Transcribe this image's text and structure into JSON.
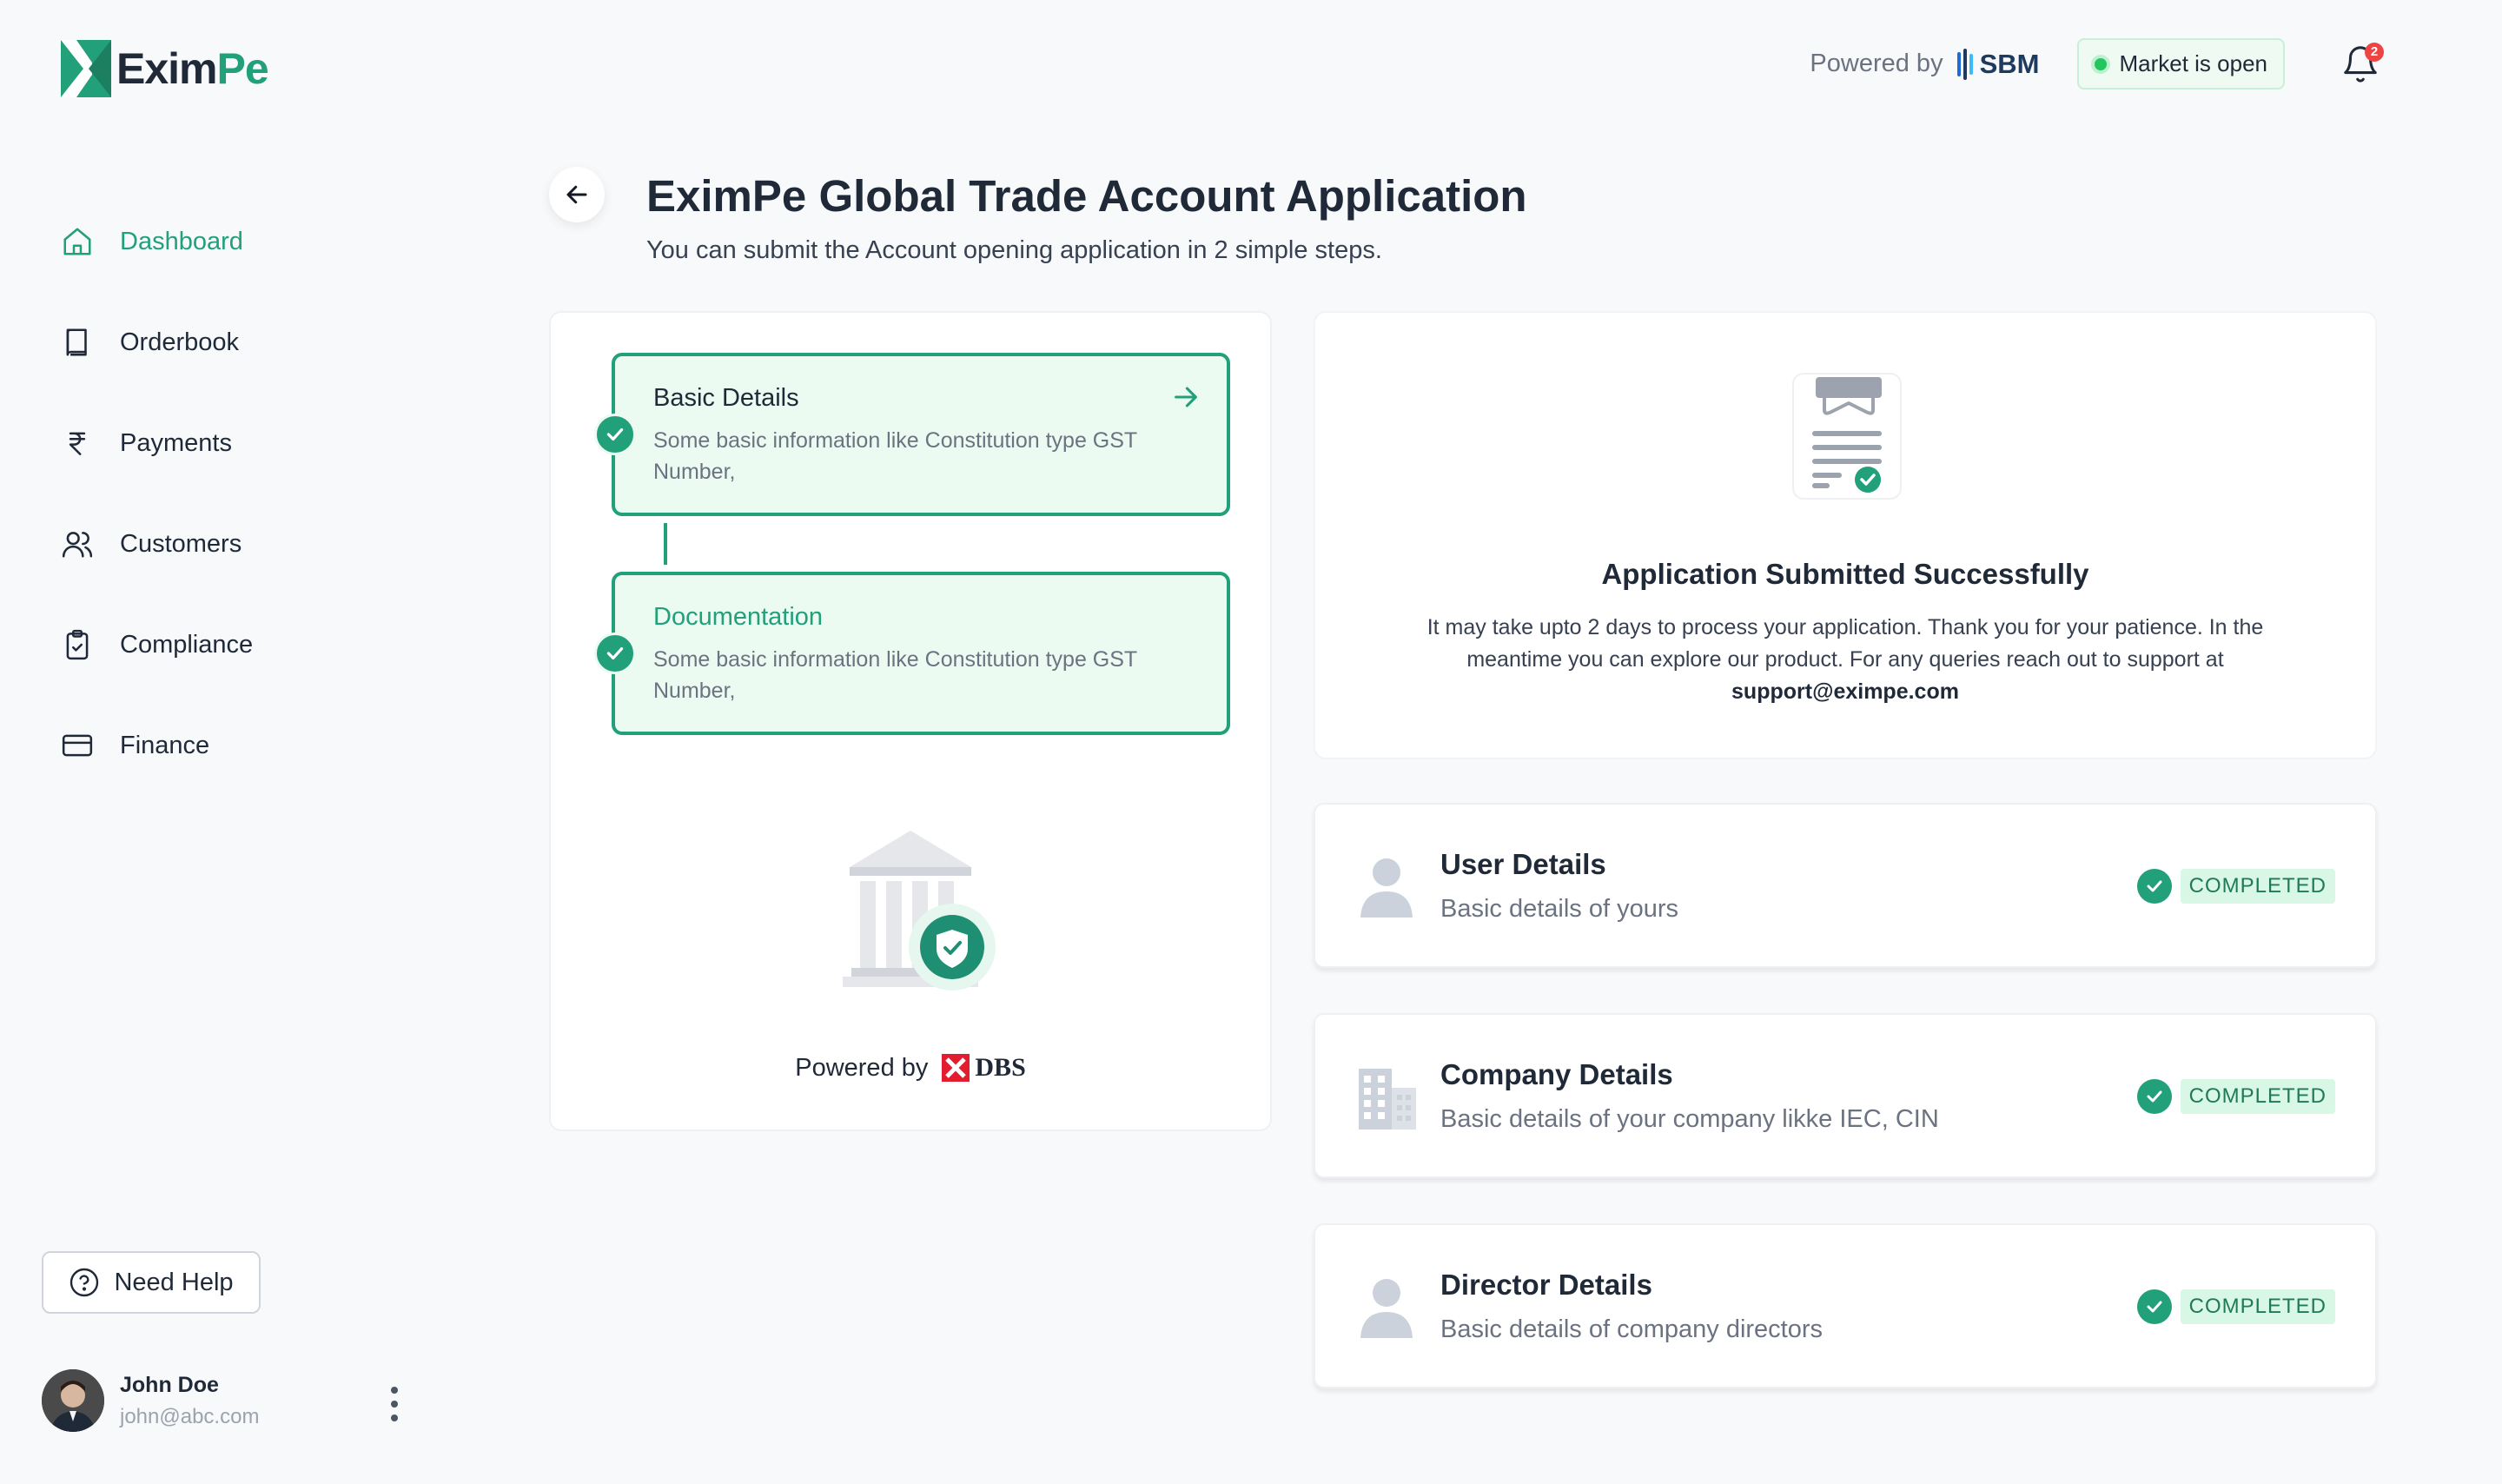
{
  "brand": {
    "name_part1": "Exim",
    "name_part2": "Pe",
    "accent": "#22a07a"
  },
  "topbar": {
    "powered_label": "Powered by",
    "partner": "SBM",
    "market_status": "Market is open",
    "notification_count": "2"
  },
  "sidebar": {
    "items": [
      {
        "label": "Dashboard",
        "icon": "home-icon",
        "active": true
      },
      {
        "label": "Orderbook",
        "icon": "book-icon"
      },
      {
        "label": "Payments",
        "icon": "rupee-icon"
      },
      {
        "label": "Customers",
        "icon": "users-icon"
      },
      {
        "label": "Compliance",
        "icon": "clipboard-check-icon"
      },
      {
        "label": "Finance",
        "icon": "credit-card-icon"
      }
    ],
    "help_label": "Need Help",
    "user": {
      "name": "John Doe",
      "email": "john@abc.com"
    }
  },
  "header": {
    "title": "EximPe Global Trade Account Application",
    "subtitle": "You can submit the Account opening application in 2 simple steps."
  },
  "steps": [
    {
      "title": "Basic Details",
      "desc": "Some basic information like Constitution type GST Number,"
    },
    {
      "title": "Documentation",
      "desc": "Some basic information like Constitution type GST Number,"
    }
  ],
  "steps_footer": {
    "powered_label": "Powered by",
    "partner": "DBS"
  },
  "success": {
    "heading": "Application Submitted Successfully",
    "body": "It may take upto 2 days to process your application. Thank you for your patience. In the meantime you can explore our product. For any queries reach out to support at",
    "email": "support@eximpe.com"
  },
  "details": [
    {
      "title": "User Details",
      "desc": "Basic details of yours",
      "status": "COMPLETED",
      "icon": "user-icon"
    },
    {
      "title": "Company Details",
      "desc": "Basic details of your company likke IEC, CIN",
      "status": "COMPLETED",
      "icon": "building-icon"
    },
    {
      "title": "Director Details",
      "desc": "Basic details of company directors",
      "status": "COMPLETED",
      "icon": "user-icon"
    }
  ]
}
